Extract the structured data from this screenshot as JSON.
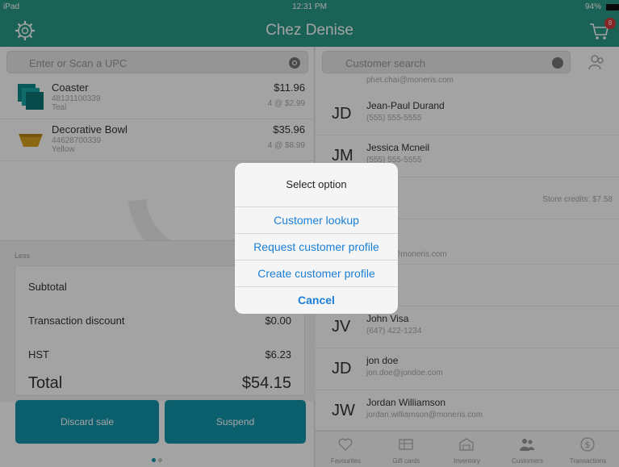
{
  "status_bar": {
    "device": "iPad",
    "time": "12:31 PM",
    "battery": "94%"
  },
  "header": {
    "title": "Chez Denise",
    "cart_badge": "8"
  },
  "sale": {
    "search_placeholder": "Enter or Scan a UPC",
    "items": [
      {
        "name": "Coaster",
        "sku": "48131100339",
        "variant": "Teal",
        "price": "$11.96",
        "unit": "4 @ $2.99"
      },
      {
        "name": "Decorative Bowl",
        "sku": "44628700339",
        "variant": "Yellow",
        "price": "$35.96",
        "unit": "4 @ $8.99"
      }
    ],
    "less_label": "Less",
    "subtotal_label": "Subtotal",
    "discount_label": "Transaction discount",
    "discount_value": "$0.00",
    "tax_label": "HST",
    "tax_value": "$6.23",
    "total_label": "Total",
    "total_value": "$54.15",
    "discard_label": "Discard sale",
    "suspend_label": "Suspend"
  },
  "customers": {
    "search_placeholder": "Customer search",
    "top_email": "phet.chai@moneris.com",
    "list": [
      {
        "initials": "JD",
        "name": "Jean-Paul Durand",
        "sub": "(555) 555-5555",
        "credit": ""
      },
      {
        "initials": "JM",
        "name": "Jessica Mcneil",
        "sub": "(555) 555-5555",
        "credit": ""
      },
      {
        "initials": "",
        "name": "oe",
        "sub": "7-7777",
        "credit": "Store credits: $7.58"
      },
      {
        "initials": "",
        "name": "mith",
        "sub": "7-8736",
        "sub2": "mieson@moneris.com",
        "credit": ""
      },
      {
        "initials": "",
        "name": "mith",
        "sub": "5-5555",
        "credit": ""
      },
      {
        "initials": "JV",
        "name": "John Visa",
        "sub": "(647) 422-1234",
        "credit": ""
      },
      {
        "initials": "JD",
        "name": "jon doe",
        "sub": "jon.doe@jondoe.com",
        "credit": ""
      },
      {
        "initials": "JW",
        "name": "Jordan Williamson",
        "sub": "jordan.williamson@moneris.com",
        "credit": ""
      }
    ],
    "tabs": [
      "Favourites",
      "Gift cards",
      "Inventory",
      "Customers",
      "Transactions"
    ]
  },
  "dialog": {
    "title": "Select option",
    "options": [
      "Customer lookup",
      "Request customer profile",
      "Create customer profile"
    ],
    "cancel": "Cancel"
  },
  "colors": {
    "brand": "#2a9a86",
    "button": "#1496ab",
    "link": "#1a7fd6"
  }
}
